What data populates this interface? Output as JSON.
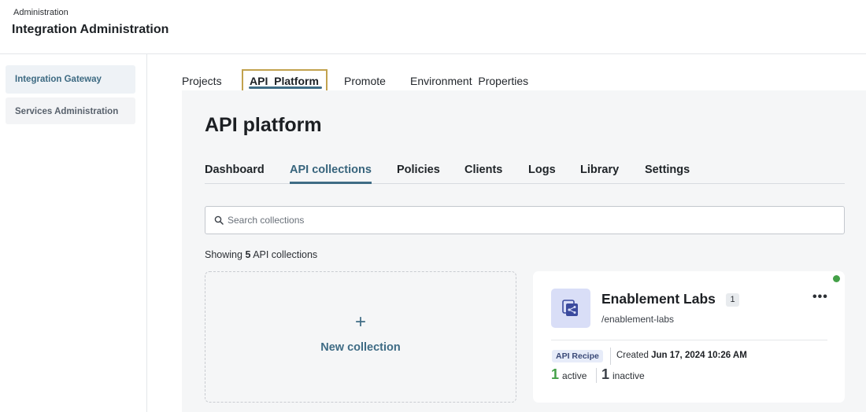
{
  "header": {
    "breadcrumb": "Administration",
    "title": "Integration Administration"
  },
  "sidebar": {
    "items": [
      {
        "label": "Integration Gateway"
      },
      {
        "label": "Services Administration"
      }
    ]
  },
  "top_tabs": [
    {
      "label": "Projects"
    },
    {
      "label": "API  Platform"
    },
    {
      "label": "Promote"
    },
    {
      "label": "Environment  Properties"
    }
  ],
  "main": {
    "title": "API platform",
    "tabs": [
      {
        "label": "Dashboard"
      },
      {
        "label": "API collections"
      },
      {
        "label": "Policies"
      },
      {
        "label": "Clients"
      },
      {
        "label": "Logs"
      },
      {
        "label": "Library"
      },
      {
        "label": "Settings"
      }
    ],
    "search": {
      "placeholder": "Search collections",
      "value": ""
    },
    "showing": {
      "prefix": "Showing",
      "count": "5",
      "suffix": "API collections"
    },
    "new_collection": {
      "plus": "+",
      "label": "New collection"
    },
    "collection": {
      "name": "Enablement Labs",
      "count": "1",
      "path": "/enablement-labs",
      "more": "•••",
      "badge": "API Recipe",
      "created_label": "Created",
      "created_date": "Jun 17, 2024 10:26 AM",
      "active_count": "1",
      "active_label": "active",
      "inactive_count": "1",
      "inactive_label": "inactive",
      "status_color": "#43a047"
    }
  },
  "colors": {
    "accent": "#3f6c85",
    "focus_outline": "#c2a24e",
    "active_green": "#43a047"
  }
}
